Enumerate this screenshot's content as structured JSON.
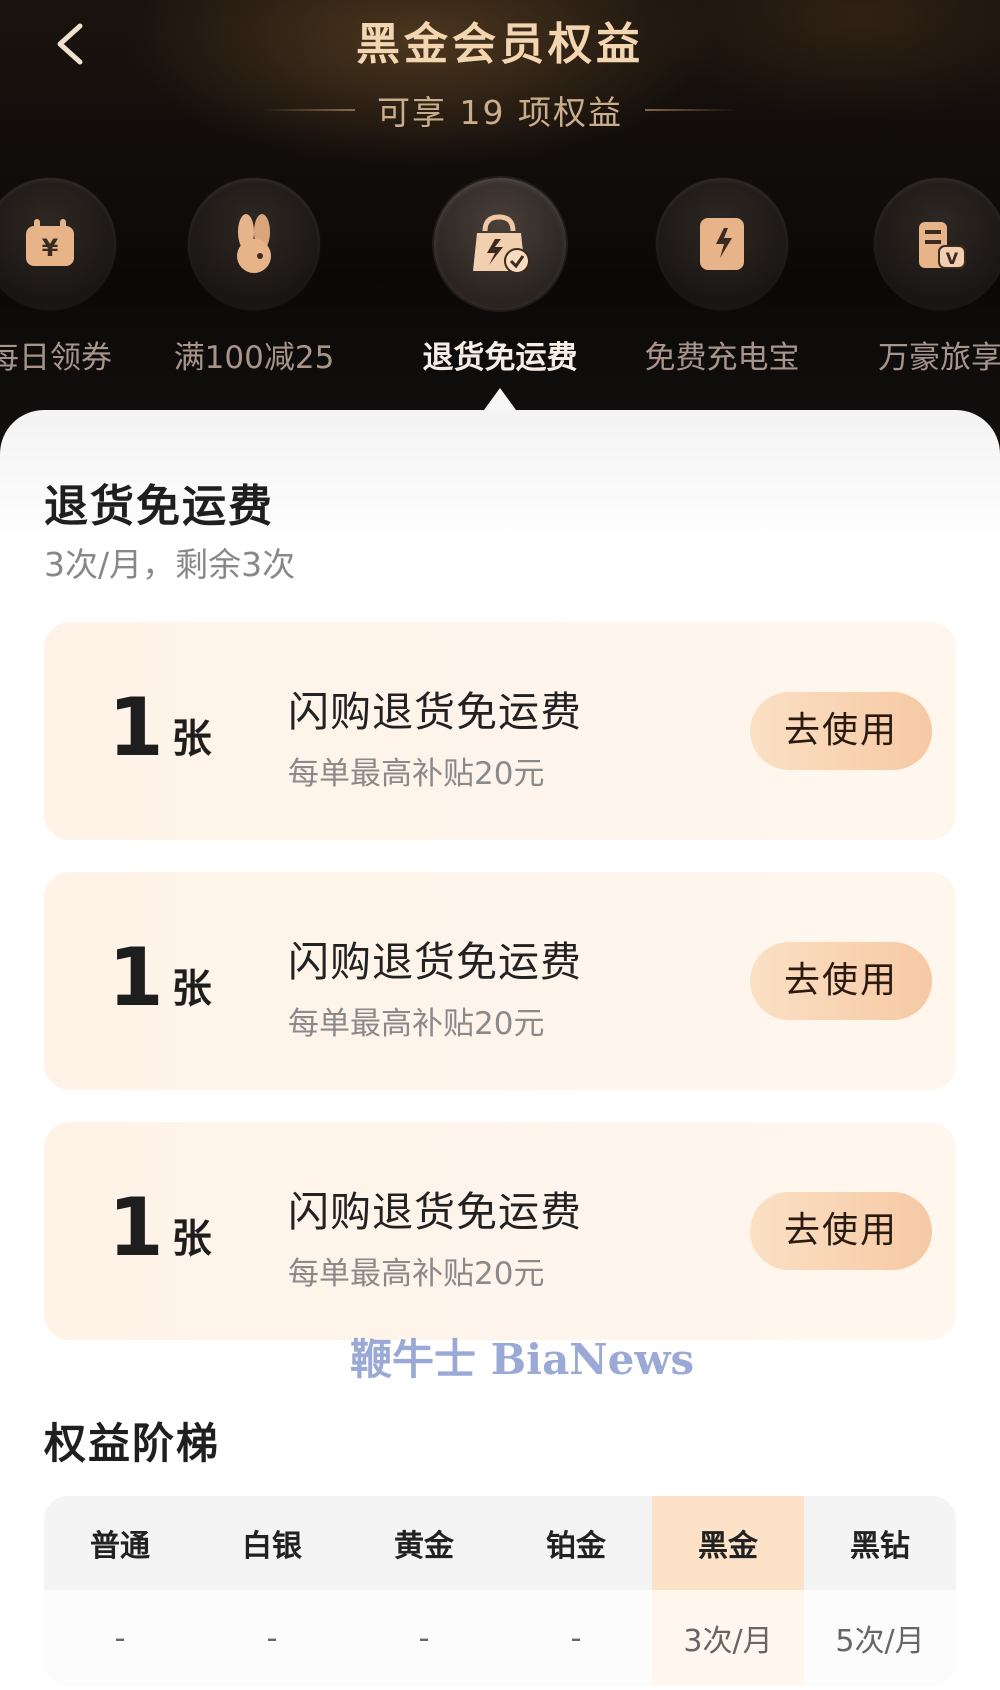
{
  "header": {
    "back_icon": "chevron-left-icon",
    "title": "黑金会员权益",
    "subtitle": "可享 19 项权益"
  },
  "tabs": [
    {
      "label": "每日领券",
      "icon": "coupon-icon",
      "active": false
    },
    {
      "label": "满100减25",
      "icon": "rabbit-icon",
      "active": false
    },
    {
      "label": "退货免运费",
      "icon": "return-bag-icon",
      "active": true
    },
    {
      "label": "免费充电宝",
      "icon": "power-bank-icon",
      "active": false
    },
    {
      "label": "万豪旅享",
      "icon": "hotel-icon",
      "active": false
    }
  ],
  "section": {
    "title": "退货免运费",
    "subtitle": "3次/月，剩余3次"
  },
  "cards": [
    {
      "count": "1",
      "unit": "张",
      "name": "闪购退货免运费",
      "desc": "每单最高补贴20元",
      "button": "去使用"
    },
    {
      "count": "1",
      "unit": "张",
      "name": "闪购退货免运费",
      "desc": "每单最高补贴20元",
      "button": "去使用"
    },
    {
      "count": "1",
      "unit": "张",
      "name": "闪购退货免运费",
      "desc": "每单最高补贴20元",
      "button": "去使用"
    }
  ],
  "watermark": "鞭牛士 BiaNews",
  "ladder": {
    "title": "权益阶梯",
    "levels": [
      "普通",
      "白银",
      "黄金",
      "铂金",
      "黑金",
      "黑钻"
    ],
    "values": [
      "-",
      "-",
      "-",
      "-",
      "3次/月",
      "5次/月"
    ],
    "highlight_level": "黑金"
  },
  "colors": {
    "header_bg": "#0b0908",
    "gold_text": "#f3d6b1",
    "card_bg": "#fff3e8",
    "button_gradient_start": "#fbe0c4",
    "button_gradient_end": "#f6c9a4",
    "highlight_cell": "#fde2c8"
  }
}
